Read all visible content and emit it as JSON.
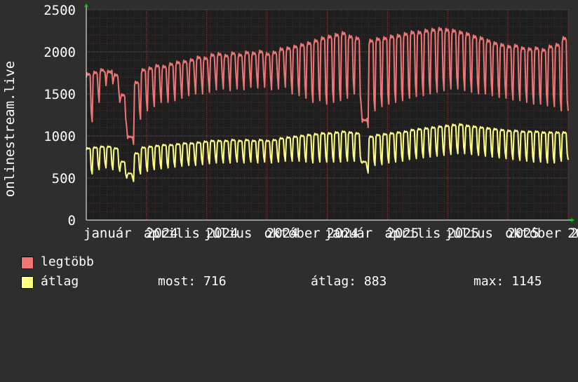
{
  "chart_data": {
    "type": "line",
    "ylabel": "onlinestream.live",
    "ylim": [
      0,
      2500
    ],
    "yticks": [
      "0",
      "500",
      "1000",
      "1500",
      "2000",
      "2500"
    ],
    "x_tick_labels": [
      "január",
      "április",
      "július",
      "október",
      "január",
      "április",
      "július",
      "október"
    ],
    "x_year_labels": [
      "2024",
      "2024",
      "2024",
      "2024",
      "2025",
      "2025",
      "2025",
      "2025"
    ],
    "x_edge_label": "2",
    "grid": true,
    "series": [
      {
        "name": "legtöbb",
        "color": "#f07575",
        "weekly_peak": [
          1750,
          1770,
          1800,
          1780,
          1740,
          1500,
          1000,
          1650,
          1800,
          1820,
          1850,
          1840,
          1870,
          1890,
          1900,
          1920,
          1950,
          1940,
          1980,
          1990,
          1970,
          2000,
          1980,
          2010,
          2000,
          2020,
          1990,
          2010,
          2050,
          2060,
          2080,
          2100,
          2120,
          2150,
          2180,
          2200,
          2220,
          2240,
          2200,
          2180,
          1200,
          2150,
          2170,
          2180,
          2200,
          2210,
          2230,
          2250,
          2250,
          2270,
          2280,
          2290,
          2280,
          2270,
          2250,
          2230,
          2200,
          2180,
          2150,
          2120,
          2100,
          2080,
          2090,
          2060,
          2050,
          2060,
          2040,
          2080,
          2100,
          2180
        ],
        "weekly_low": [
          1170,
          1400,
          1600,
          1620,
          1400,
          1100,
          900,
          1200,
          1300,
          1350,
          1400,
          1400,
          1420,
          1450,
          1480,
          1500,
          1500,
          1520,
          1550,
          1560,
          1540,
          1560,
          1550,
          1580,
          1570,
          1580,
          1550,
          1560,
          1580,
          1500,
          1480,
          1450,
          1400,
          1420,
          1380,
          1400,
          1420,
          1450,
          1500,
          1350,
          1100,
          1300,
          1350,
          1380,
          1400,
          1420,
          1450,
          1470,
          1480,
          1500,
          1520,
          1540,
          1560,
          1560,
          1540,
          1520,
          1500,
          1500,
          1480,
          1460,
          1450,
          1430,
          1420,
          1400,
          1380,
          1380,
          1360,
          1350,
          1300,
          1300
        ]
      },
      {
        "name": "átlag",
        "color": "#ffff80",
        "weekly_peak": [
          860,
          870,
          880,
          880,
          860,
          700,
          560,
          800,
          870,
          880,
          890,
          900,
          900,
          910,
          920,
          920,
          930,
          940,
          950,
          950,
          950,
          960,
          950,
          960,
          950,
          960,
          950,
          960,
          980,
          990,
          1000,
          1010,
          1020,
          1030,
          1040,
          1040,
          1050,
          1060,
          1050,
          1040,
          700,
          1000,
          1020,
          1030,
          1040,
          1050,
          1060,
          1080,
          1090,
          1100,
          1110,
          1120,
          1130,
          1140,
          1145,
          1130,
          1120,
          1110,
          1100,
          1090,
          1080,
          1070,
          1070,
          1060,
          1060,
          1060,
          1050,
          1050,
          1050,
          1050
        ],
        "weekly_low": [
          550,
          600,
          620,
          600,
          580,
          500,
          460,
          550,
          580,
          600,
          610,
          620,
          630,
          640,
          650,
          650,
          660,
          670,
          680,
          680,
          680,
          690,
          680,
          690,
          680,
          690,
          680,
          690,
          700,
          700,
          700,
          690,
          680,
          690,
          690,
          690,
          690,
          700,
          700,
          690,
          560,
          650,
          660,
          680,
          690,
          700,
          720,
          730,
          740,
          750,
          760,
          770,
          780,
          790,
          790,
          780,
          770,
          760,
          750,
          740,
          730,
          720,
          710,
          700,
          690,
          690,
          680,
          680,
          700,
          716
        ]
      }
    ]
  },
  "legend": {
    "items": [
      {
        "label": "legtöbb",
        "color": "#f07575"
      },
      {
        "label": "átlag",
        "color": "#ffff80"
      }
    ],
    "stats": {
      "most_label": "most:",
      "most_value": "716",
      "atlag_label": "átlag:",
      "atlag_value": "883",
      "max_label": "max:",
      "max_value": "1145"
    }
  }
}
